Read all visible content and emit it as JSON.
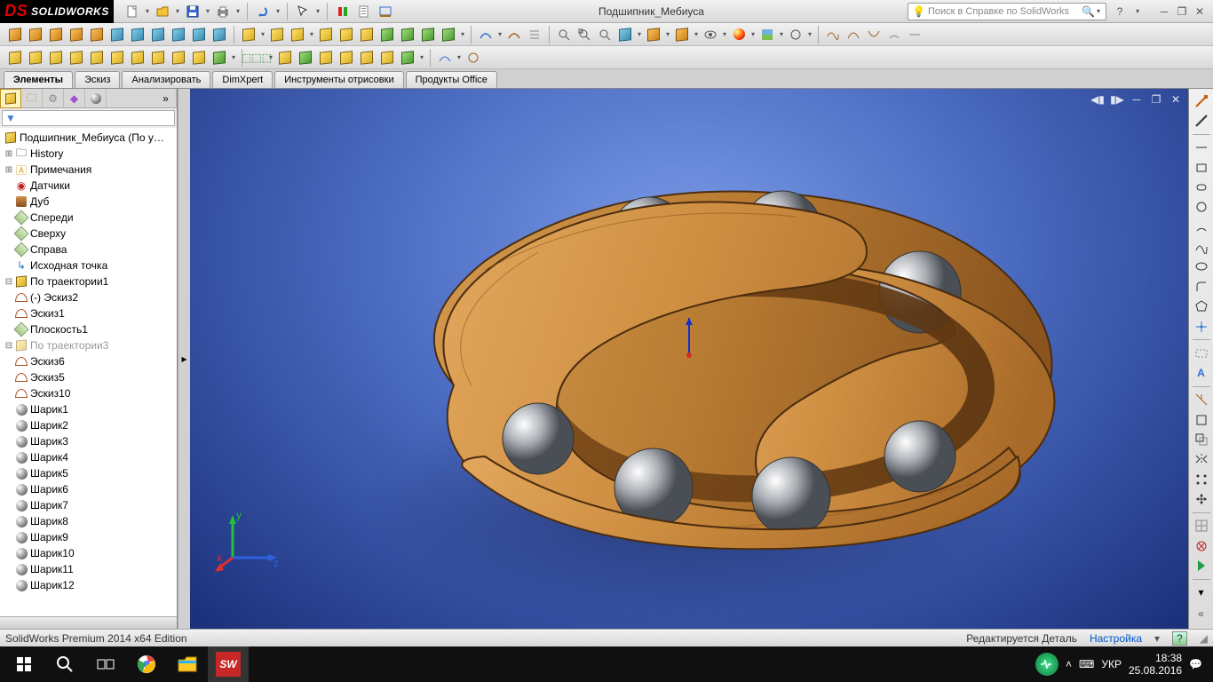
{
  "app": {
    "logo_ds": "DS",
    "logo_text": "SOLIDWORKS",
    "title": "Подшипник_Мебиуса"
  },
  "search": {
    "placeholder": "Поиск в Справке по SolidWorks"
  },
  "tabs": {
    "t0": "Элементы",
    "t1": "Эскиз",
    "t2": "Анализировать",
    "t3": "DimXpert",
    "t4": "Инструменты отрисовки",
    "t5": "Продукты Office"
  },
  "tree": {
    "root": "Подшипник_Мебиуса  (По у…",
    "history": "History",
    "notes": "Примечания",
    "sensors": "Датчики",
    "dub": "Дуб",
    "front": "Спереди",
    "top": "Сверху",
    "right": "Справа",
    "origin": "Исходная точка",
    "traj1": "По траектории1",
    "sk2": "(-) Эскиз2",
    "sk1": "Эскиз1",
    "plane1": "Плоскость1",
    "traj3": "По траектории3",
    "sk6": "Эскиз6",
    "sk5": "Эскиз5",
    "sk10": "Эскиз10",
    "b1": "Шарик1",
    "b2": "Шарик2",
    "b3": "Шарик3",
    "b4": "Шарик4",
    "b5": "Шарик5",
    "b6": "Шарик6",
    "b7": "Шарик7",
    "b8": "Шарик8",
    "b9": "Шарик9",
    "b10": "Шарик10",
    "b11": "Шарик11",
    "b12": "Шарик12"
  },
  "triad": {
    "x": "x",
    "y": "y",
    "z": "z"
  },
  "status": {
    "edition": "SolidWorks Premium 2014 x64 Edition",
    "mode": "Редактируется Деталь",
    "settings": "Настройка",
    "help": "?"
  },
  "taskbar": {
    "lang": "УКР",
    "time": "18:38",
    "date": "25.08.2016"
  }
}
